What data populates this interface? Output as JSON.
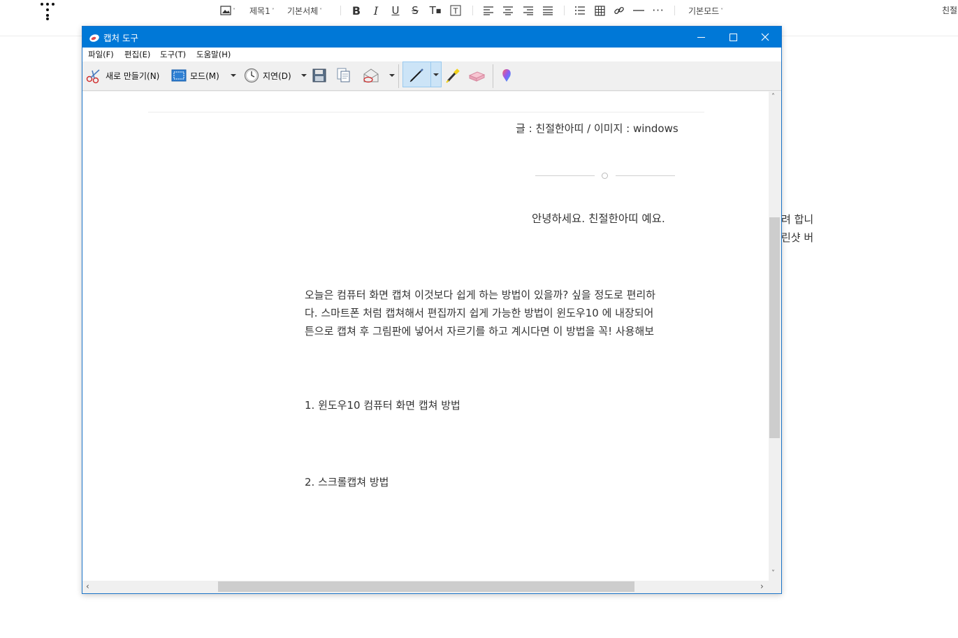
{
  "editor": {
    "toolbar": {
      "heading_select": "제목1",
      "font_select": "기본서체",
      "mode_select": "기본모드",
      "right_text": "친절"
    },
    "side_text": [
      "려 합니",
      "린샷 버"
    ]
  },
  "window": {
    "title": "캡처 도구",
    "menu": [
      "파일(F)",
      "편집(E)",
      "도구(T)",
      "도움말(H)"
    ],
    "toolbar": {
      "new_label": "새로 만들기(N)",
      "mode_label": "모드(M)",
      "delay_label": "지연(D)"
    },
    "content": {
      "credit": "글 : 친절한아띠 / 이미지 : windows",
      "greeting": "안녕하세요. 친절한아띠 예요.",
      "paragraph": [
        "오늘은 컴퓨터 화면 캡쳐 이것보다 쉽게 하는 방법이 있을까? 싶을 정도로 편리하",
        "다. 스마트폰 처럼 캡쳐해서 편집까지 쉽게 가능한 방법이 윈도우10 에 내장되어",
        "튼으로 캡쳐 후 그림판에 넣어서 자르기를 하고 계시다면 이 방법을 꼭! 사용해보"
      ],
      "section1": "1. 윈도우10 컴퓨터 화면 캡쳐 방법",
      "section2": "2. 스크롤캡쳐 방법"
    }
  },
  "colors": {
    "titlebar": "#0078d7",
    "pen_active_bg": "#cce4f7"
  }
}
